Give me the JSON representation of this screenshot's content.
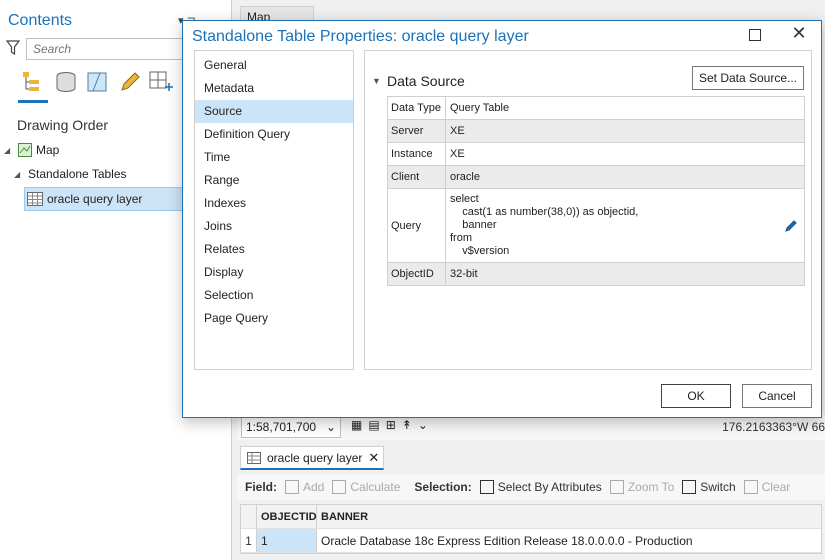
{
  "contents": {
    "title": "Contents",
    "pin_glyph": "▾ ⊐",
    "search_placeholder": "Search",
    "drawing_order": "Drawing Order",
    "tree": {
      "map": "Map",
      "standalone_tables": "Standalone Tables",
      "oracle_layer": "oracle query layer"
    }
  },
  "background": {
    "map_tab": "Map",
    "scale": "1:58,701,700",
    "coordinates": "176.2163363°W 66",
    "table_tab": "oracle query layer",
    "toolbar": {
      "field_label": "Field:",
      "add": "Add",
      "calculate": "Calculate",
      "selection_label": "Selection:",
      "select_by_attributes": "Select By Attributes",
      "zoom_to": "Zoom To",
      "switch": "Switch",
      "clear": "Clear"
    },
    "table": {
      "headers": [
        "OBJECTID",
        "BANNER"
      ],
      "rows": [
        {
          "rownum": "1",
          "objectid": "1",
          "banner": "Oracle Database 18c Express Edition Release 18.0.0.0.0 - Production"
        }
      ]
    }
  },
  "dialog": {
    "title": "Standalone Table Properties: oracle query layer",
    "nav": [
      {
        "label": "General"
      },
      {
        "label": "Metadata"
      },
      {
        "label": "Source"
      },
      {
        "label": "Definition Query"
      },
      {
        "label": "Time"
      },
      {
        "label": "Range"
      },
      {
        "label": "Indexes"
      },
      {
        "label": "Joins"
      },
      {
        "label": "Relates"
      },
      {
        "label": "Display"
      },
      {
        "label": "Selection"
      },
      {
        "label": "Page Query"
      }
    ],
    "active_nav": "Source",
    "section_title": "Data Source",
    "set_data_source": "Set Data Source...",
    "properties": {
      "data_type": {
        "key": "Data Type",
        "value": "Query Table"
      },
      "server": {
        "key": "Server",
        "value": "XE"
      },
      "instance": {
        "key": "Instance",
        "value": "XE"
      },
      "client": {
        "key": "Client",
        "value": "oracle"
      },
      "query": {
        "key": "Query",
        "value": "select\n    cast(1 as number(38,0)) as objectid,\n    banner\nfrom\n    v$version"
      },
      "objectid": {
        "key": "ObjectID",
        "value": "32-bit"
      }
    },
    "ok": "OK",
    "cancel": "Cancel"
  },
  "colors": {
    "accent": "#1b72b8",
    "selection": "#cce4f7"
  }
}
